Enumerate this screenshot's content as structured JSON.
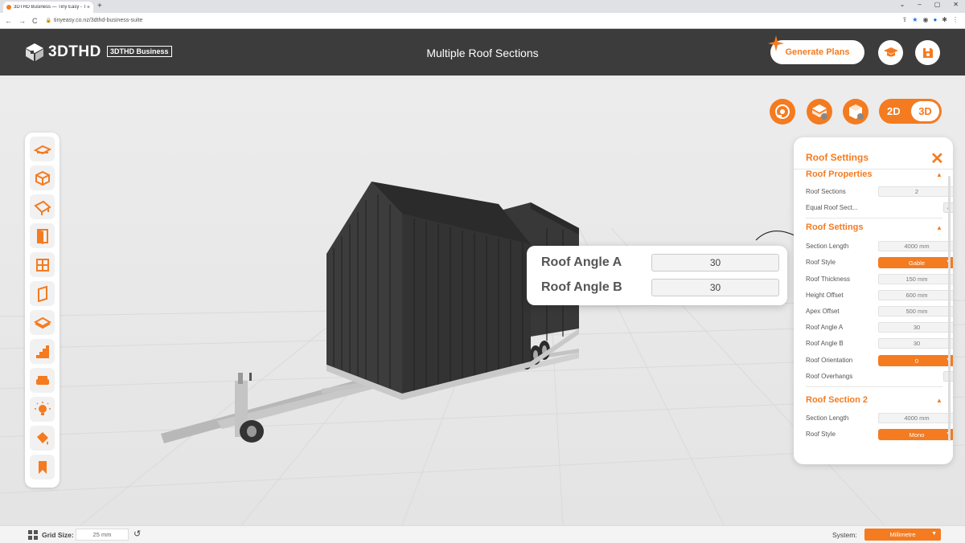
{
  "browser": {
    "tab_title": "3DTHD Business — Tiny Easy - T",
    "tab_close": "×",
    "new_tab": "+",
    "url": "tinyeasy.co.nz/3dthd-business-suite",
    "back": "←",
    "forward": "→",
    "reload": "C",
    "window_controls": [
      "⌄",
      "–",
      "▢",
      "✕"
    ]
  },
  "header": {
    "brand": "3DTHD",
    "badge": "3DTHD Business",
    "page_title": "Multiple Roof Sections",
    "generate_plans": "Generate Plans"
  },
  "view_toggle": {
    "mode_2d": "2D",
    "mode_3d": "3D",
    "active": "3D"
  },
  "callout": {
    "rows": [
      {
        "label": "Roof Angle A",
        "value": "30"
      },
      {
        "label": "Roof Angle B",
        "value": "30"
      }
    ]
  },
  "panel": {
    "title": "Roof Settings",
    "close": "✕",
    "sections": {
      "roof_properties": {
        "title": "Roof Properties",
        "roof_sections_label": "Roof Sections",
        "roof_sections_value": "2",
        "equal_label": "Equal Roof Sect...",
        "equal_checked": "✓"
      },
      "roof_settings": {
        "title": "Roof Settings",
        "section_length_label": "Section Length",
        "section_length_value": "4000 mm",
        "roof_style_label": "Roof Style",
        "roof_style_value": "Gable",
        "roof_thickness_label": "Roof Thickness",
        "roof_thickness_value": "150 mm",
        "height_offset_label": "Height Offset",
        "height_offset_value": "600 mm",
        "apex_offset_label": "Apex Offset",
        "apex_offset_value": "500 mm",
        "roof_angle_a_label": "Roof Angle A",
        "roof_angle_a_value": "30",
        "roof_angle_b_label": "Roof Angle B",
        "roof_angle_b_value": "30",
        "roof_orientation_label": "Roof Orientation",
        "roof_orientation_value": "0",
        "roof_overhangs_label": "Roof Overhangs"
      },
      "roof_section_2": {
        "title": "Roof Section 2",
        "section_length_label": "Section Length",
        "section_length_value": "4000 mm",
        "roof_style_label": "Roof Style",
        "roof_style_value": "Mono"
      }
    }
  },
  "statusbar": {
    "grid_size_label": "Grid Size:",
    "grid_size_value": "25 mm",
    "system_label": "System:",
    "system_value": "Millimetre"
  },
  "colors": {
    "accent": "#f47b20",
    "header_bg": "#3c3c3c",
    "viewport_bg": "#ececec",
    "tiny_house": "#3d3d3d",
    "trailer": "#b5b5b5"
  },
  "icons": {
    "toolbar": [
      "floor-plan-icon",
      "box-icon",
      "roof-icon",
      "door-icon",
      "window-icon",
      "wall-panel-icon",
      "floor-icon",
      "stairs-icon",
      "sofa-icon",
      "light-icon",
      "paint-bucket-icon",
      "bookmark-icon"
    ],
    "view": [
      "camera-icon",
      "layer-view-icon",
      "wall-view-icon"
    ]
  }
}
